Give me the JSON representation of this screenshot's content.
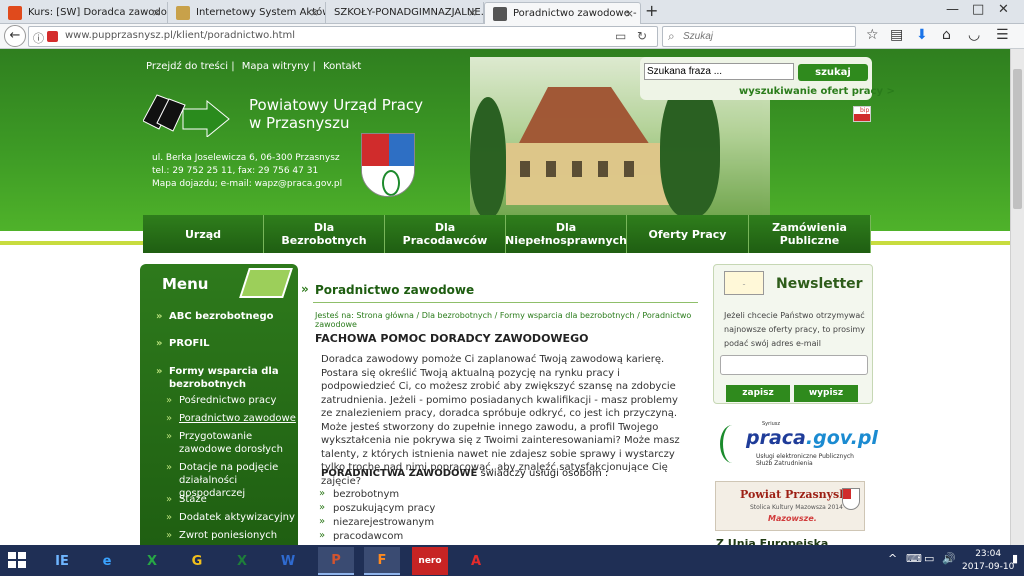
{
  "browser": {
    "tabs": [
      {
        "title": "Kurs: [SW] Doradca zawodo…",
        "color": "#e04a1c"
      },
      {
        "title": "Internetowy System Aktów P…",
        "color": "#c8a14a"
      },
      {
        "title": "SZKOŁY-PONADGIMNAZJALNE…",
        "color": "#3b7a2a"
      },
      {
        "title": "Poradnictwo zawodowe - P…",
        "color": "#555555"
      }
    ],
    "new_tab": "+",
    "close_icon": "×",
    "window_controls": [
      "—",
      "□",
      "✕"
    ],
    "url": "www.pupprzasnysz.pl/klient/poradnictwo.html",
    "search_placeholder": "Szukaj"
  },
  "site": {
    "top_links": [
      "Przejdź do treści |",
      "Mapa witryny |",
      "Kontakt"
    ],
    "institution_line1": "Powiatowy Urząd Pracy",
    "institution_line2": "w Przasnyszu",
    "address_line1": "ul. Berka Joselewicza 6, 06-300 Przasnysz",
    "address_line2": "tel.: 29 752 25 11, fax: 29 756 47 31",
    "address_line3": "Mapa dojazdu; e-mail: wapz@praca.gov.pl",
    "search_value": "Szukana fraza ...",
    "search_button": "szukaj",
    "advanced_search": "wyszukiwanie ofert pracy >",
    "bip": "bip",
    "nav": [
      {
        "label": "Urząd"
      },
      {
        "label": "Dla Bezrobotnych"
      },
      {
        "label": "Dla Pracodawców"
      },
      {
        "label": "Dla Niepełnosprawnych"
      },
      {
        "label": "Oferty Pracy"
      },
      {
        "label": "Zamówienia Publiczne"
      }
    ],
    "brand_color": "#2e7a1c"
  },
  "menu": {
    "title": "Menu",
    "items": [
      {
        "label": "ABC bezrobotnego"
      },
      {
        "label": "PROFIL"
      },
      {
        "label": "Formy wsparcia dla"
      },
      {
        "label": "bezrobotnych"
      }
    ],
    "subitems": [
      {
        "label": "Pośrednictwo pracy"
      },
      {
        "label": "Poradnictwo zawodowe"
      },
      {
        "label": "Przygotowanie"
      },
      {
        "label": "zawodowe dorosłych"
      },
      {
        "label": "Dotacje na podjęcie"
      },
      {
        "label": "działalności gospodarczej"
      },
      {
        "label": "Staże"
      },
      {
        "label": "Dodatek aktywizacyjny"
      },
      {
        "label": "Zwrot poniesionych"
      }
    ]
  },
  "content": {
    "title": "Poradnictwo zawodowe",
    "breadcrumb": "Jesteś na: Strona główna / Dla bezrobotnych / Formy wsparcia dla bezrobotnych / Poradnictwo zawodowe",
    "heading": "FACHOWA POMOC DORADCY ZAWODOWEGO",
    "paragraph": "Doradca zawodowy pomoże Ci zaplanować Twoją zawodową karierę. Postara się określić Twoją aktualną pozycję na rynku pracy i podpowiedzieć Ci, co możesz zrobić aby zwiększyć szansę na zdobycie zatrudnienia. Jeżeli - pomimo posiadanych kwalifikacji - masz problemy ze znalezieniem pracy, doradca spróbuje odkryć, co jest ich przyczyną. Może jesteś stworzony do zupełnie innego zawodu, a profil Twojego wykształcenia nie pokrywa się z Twoimi zainteresowaniami? Może masz talenty, z których istnienia nawet nie zdajesz sobie sprawy i wystarczy tylko trochę nad nimi popracować, aby znaleźć satysfakcjonujące Cię zajęcie?",
    "lead_bold": "PORADNICTWA ZAWODOWE",
    "lead_rest": " świadczy usługi osobom :",
    "list": [
      "bezrobotnym",
      "poszukującym pracy",
      "niezarejestrowanym",
      "pracodawcom"
    ]
  },
  "newsletter": {
    "title": "Newsletter",
    "text": "Jeżeli chcecie Państwo otrzymywać najnowsze oferty pracy, to prosimy podać swój adres e-mail",
    "subscribe": "zapisz",
    "unsubscribe": "wypisz"
  },
  "banners": {
    "praca_brand": "Syriusz",
    "praca_main": "praca",
    "praca_domain": ".gov.pl",
    "praca_sub": "Usługi elektroniczne Publicznych Służb Zatrudnienia",
    "powiat_title": "Powiat Przasnyski",
    "powiat_sub": "Stolica Kultury Mazowsza 2014",
    "powiat_logo": "Mazowsze.",
    "next_heading": "Z Unią Europejską…"
  },
  "taskbar": {
    "apps": [
      "IE",
      "e",
      "X",
      "G",
      "X",
      "W",
      "P",
      "F",
      "nero",
      "A"
    ],
    "tray_icons": [
      "^",
      "⌨",
      "▭",
      "🔊",
      "▮"
    ],
    "time": "23:04",
    "date": "2017-09-10"
  }
}
